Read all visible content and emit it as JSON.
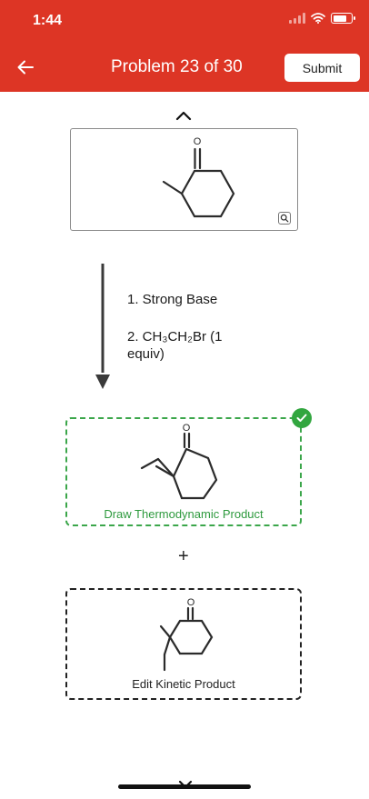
{
  "status_bar": {
    "time": "1:44",
    "icons": [
      "signal-icon",
      "wifi-icon",
      "battery-icon"
    ]
  },
  "header": {
    "title": "Problem 23 of 30",
    "submit_label": "Submit",
    "back_icon": "arrow-left-icon"
  },
  "colors": {
    "header_bg": "#dd3525",
    "success_green": "#3ba64a",
    "text_dark": "#222222"
  },
  "starting_material": {
    "atom_label": "O",
    "zoom_icon": "magnifier-icon"
  },
  "reagents": [
    "1. Strong Base",
    "2. CH₃CH₂Br (1",
    "equiv)"
  ],
  "thermodynamic": {
    "atom_label": "O",
    "label": "Draw Thermodynamic Product",
    "status_icon": "check-icon"
  },
  "plus_sign": "+",
  "kinetic": {
    "atom_label": "O",
    "label": "Edit Kinetic Product"
  }
}
